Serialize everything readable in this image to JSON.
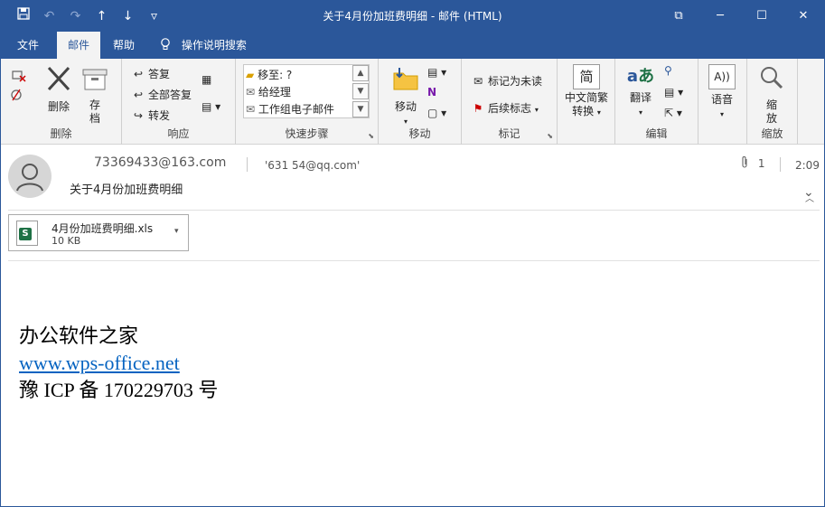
{
  "window": {
    "title": "关于4月份加班费明细  -  邮件 (HTML)",
    "qat": {
      "save": "💾",
      "undo": "↶",
      "redo": "↷",
      "up": "↑",
      "down": "↓",
      "customize": "▿"
    },
    "controls": {
      "ribbon_options": "⧉",
      "minimize": "─",
      "maximize": "☐",
      "close": "✕"
    }
  },
  "tabs": [
    {
      "label": "文件",
      "active": false
    },
    {
      "label": "邮件",
      "active": true
    },
    {
      "label": "帮助",
      "active": false
    }
  ],
  "tell_me": {
    "icon": "lightbulb-icon",
    "label": "操作说明搜索"
  },
  "ribbon": {
    "groups": {
      "delete": {
        "label": "删除",
        "ignore": "🗑",
        "delete_btn": "删除",
        "archive_line1": "存",
        "archive_line2": "档"
      },
      "respond": {
        "label": "响应",
        "reply": "答复",
        "reply_all": "全部答复",
        "forward": "转发"
      },
      "quick_steps": {
        "label": "快速步骤",
        "items": [
          "移至: ?",
          "给经理",
          "工作组电子邮件"
        ]
      },
      "move": {
        "label": "移动",
        "move_btn": "移动"
      },
      "tags": {
        "label": "标记",
        "mark_unread": "标记为未读",
        "follow_up": "后续标志"
      },
      "chinese": {
        "line1": "中文简繁",
        "line2": "转换",
        "glyph": "简"
      },
      "editing": {
        "label": "编辑",
        "translate": "翻译"
      },
      "speech": {
        "label": "语音",
        "glyph": "A))"
      },
      "zoom": {
        "label": "缩放",
        "line1": "缩",
        "line2": "放"
      }
    }
  },
  "message": {
    "from": "73369433@163.com",
    "to": "'631        54@qq.com'",
    "subject": "关于4月份加班费明细",
    "attachment_count": "1",
    "time": "2:09",
    "attachment": {
      "name": "4月份加班费明细.xls",
      "size": "10 KB"
    },
    "body": {
      "line1": "办公软件之家",
      "link": "www.wps-office.net",
      "line3": "豫 ICP 备 170229703 号"
    }
  },
  "colors": {
    "titlebar": "#2b579a",
    "ribbon": "#f3f3f3",
    "link": "#0563c1",
    "excel": "#1e7145"
  }
}
